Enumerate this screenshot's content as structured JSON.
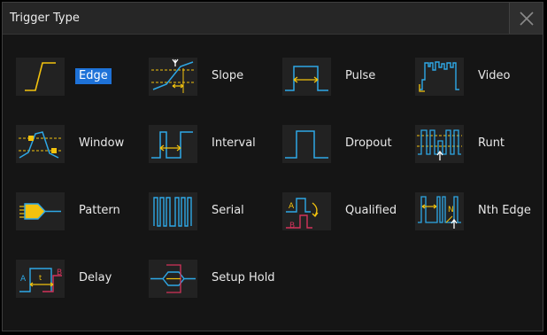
{
  "dialog": {
    "title": "Trigger Type",
    "close_icon": "close-icon"
  },
  "colors": {
    "waveform_blue": "#2ea8e6",
    "marker_yellow": "#f2c20e",
    "marker_red": "#d2335a",
    "selected_bg": "#1e72d8"
  },
  "trigger_types": [
    {
      "id": "edge",
      "label": "Edge",
      "icon": "edge-icon",
      "selected": true
    },
    {
      "id": "slope",
      "label": "Slope",
      "icon": "slope-icon",
      "selected": false
    },
    {
      "id": "pulse",
      "label": "Pulse",
      "icon": "pulse-icon",
      "selected": false
    },
    {
      "id": "video",
      "label": "Video",
      "icon": "video-icon",
      "selected": false
    },
    {
      "id": "window",
      "label": "Window",
      "icon": "window-icon",
      "selected": false
    },
    {
      "id": "interval",
      "label": "Interval",
      "icon": "interval-icon",
      "selected": false
    },
    {
      "id": "dropout",
      "label": "Dropout",
      "icon": "dropout-icon",
      "selected": false
    },
    {
      "id": "runt",
      "label": "Runt",
      "icon": "runt-icon",
      "selected": false
    },
    {
      "id": "pattern",
      "label": "Pattern",
      "icon": "pattern-icon",
      "selected": false
    },
    {
      "id": "serial",
      "label": "Serial",
      "icon": "serial-icon",
      "selected": false
    },
    {
      "id": "qualified",
      "label": "Qualified",
      "icon": "qualified-icon",
      "selected": false
    },
    {
      "id": "nth-edge",
      "label": "Nth Edge",
      "icon": "nth-edge-icon",
      "selected": false
    },
    {
      "id": "delay",
      "label": "Delay",
      "icon": "delay-icon",
      "selected": false
    },
    {
      "id": "setup-hold",
      "label": "Setup Hold",
      "icon": "setup-hold-icon",
      "selected": false
    }
  ],
  "icon_text": {
    "delay_a": "A",
    "delay_t": "t",
    "delay_b": "B",
    "qualified_a": "A",
    "qualified_b": "B",
    "nth_n": "N"
  }
}
